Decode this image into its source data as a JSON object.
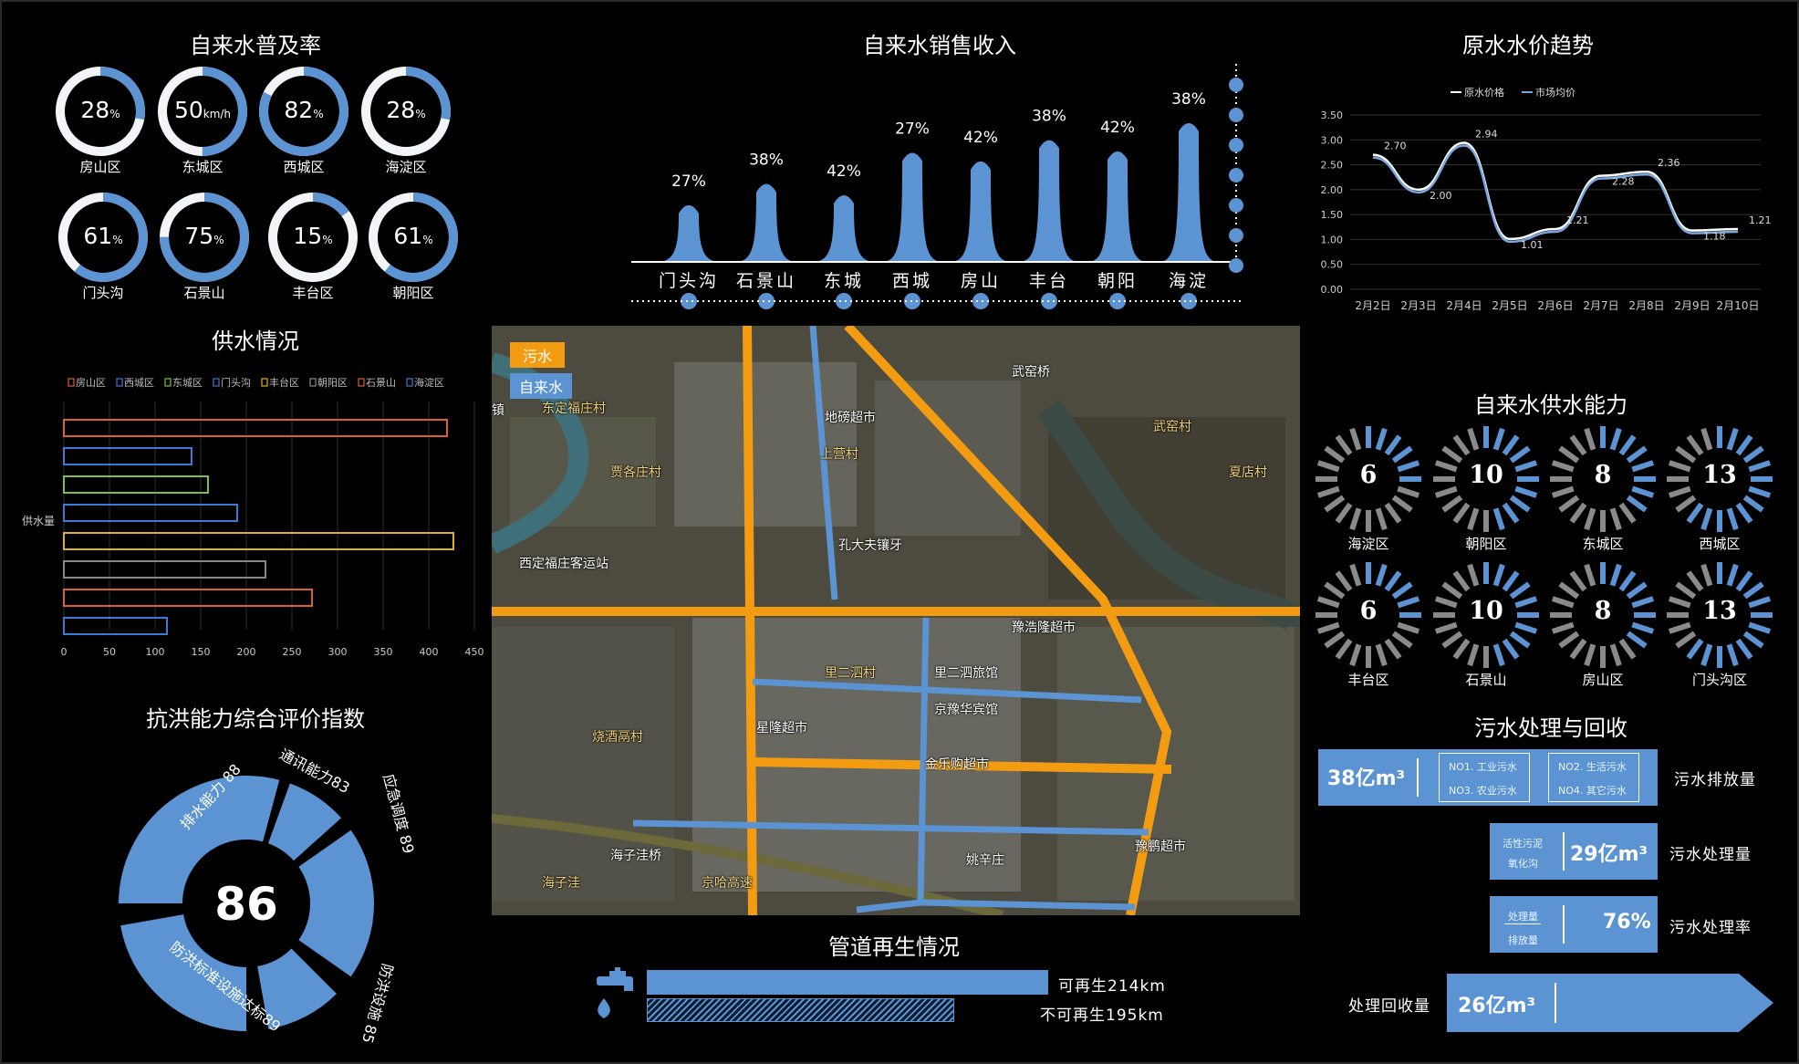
{
  "titles": {
    "coverage": "自来水普及率",
    "sales": "自来水销售收入",
    "price": "原水水价趋势",
    "supply": "供水情况",
    "capacity": "自来水供水能力",
    "flood": "抗洪能力综合评价指数",
    "sewage": "污水处理与回收",
    "pipe": "管道再生情况"
  },
  "colors": {
    "accent": "#5b93d3",
    "ring_bg": "#ffffff",
    "orange": "#f39c12"
  },
  "coverage_rings": [
    {
      "label": "房山区",
      "value": "28",
      "unit": "%",
      "fraction": 0.28
    },
    {
      "label": "东城区",
      "value": "50",
      "unit": "km/h",
      "fraction": 0.5
    },
    {
      "label": "西城区",
      "value": "82",
      "unit": "%",
      "fraction": 0.82
    },
    {
      "label": "海淀区",
      "value": "28",
      "unit": "%",
      "fraction": 0.28
    },
    {
      "label": "门头沟",
      "value": "61",
      "unit": "%",
      "fraction": 0.61
    },
    {
      "label": "石景山",
      "value": "75",
      "unit": "%",
      "fraction": 0.75
    },
    {
      "label": "丰台区",
      "value": "15",
      "unit": "%",
      "fraction": 0.15
    },
    {
      "label": "朝阳区",
      "value": "61",
      "unit": "%",
      "fraction": 0.61
    }
  ],
  "capacity": [
    {
      "label": "海淀区",
      "value": "6",
      "filled": 6
    },
    {
      "label": "朝阳区",
      "value": "10",
      "filled": 10
    },
    {
      "label": "东城区",
      "value": "8",
      "filled": 8
    },
    {
      "label": "西城区",
      "value": "13",
      "filled": 13
    },
    {
      "label": "丰台区",
      "value": "6",
      "filled": 6
    },
    {
      "label": "石景山",
      "value": "10",
      "filled": 10
    },
    {
      "label": "房山区",
      "value": "8",
      "filled": 8
    },
    {
      "label": "门头沟区",
      "value": "13",
      "filled": 13
    }
  ],
  "flood": {
    "center": "86",
    "segments": [
      {
        "label": "排水能力 88",
        "value": 88
      },
      {
        "label": "通讯能力83",
        "value": 83
      },
      {
        "label": "应急调度 89",
        "value": 89
      },
      {
        "label": "防洪设施 85",
        "value": 85
      },
      {
        "label": "防洪标准设施达标89",
        "value": 89
      }
    ]
  },
  "sewage": {
    "discharge": {
      "value": "38亿m³",
      "label": "污水排放量",
      "items": [
        "NO1. 工业污水",
        "NO2. 生活污水",
        "NO3. 农业污水",
        "NO4. 其它污水"
      ]
    },
    "treated": {
      "value": "29亿m³",
      "label": "污水处理量",
      "sub": [
        "活性污泥",
        "氧化沟"
      ]
    },
    "rate": {
      "value": "76%",
      "label": "污水处理率",
      "sub": [
        "处理量",
        "排放量"
      ]
    },
    "recycled": {
      "value": "26亿m³",
      "label": "处理回收量"
    }
  },
  "pipe": {
    "renewable": {
      "label": "可再生214km",
      "value": 214
    },
    "nonrenewable": {
      "label": "不可再生195km",
      "value": 195
    }
  },
  "map": {
    "legend": [
      "污水",
      "自来水"
    ],
    "places": [
      "武窑桥",
      "地磅超市",
      "东定福庄村",
      "贾各庄村",
      "西定福庄客运站",
      "孔大夫镶牙",
      "武窑村",
      "夏店村",
      "烧酒鬲村",
      "里二泗村",
      "里二泗旅馆",
      "豫浩隆超市",
      "京豫华宾馆",
      "星隆超市",
      "金乐购超市",
      "海子洼桥",
      "海子洼",
      "姚辛庄",
      "京哈高速",
      "豫鹏超市",
      "上营村",
      "镇"
    ]
  },
  "chart_data": [
    {
      "type": "area",
      "title": "自来水销售收入",
      "categories": [
        "门头沟",
        "石景山",
        "东城",
        "西城",
        "房山",
        "丰台",
        "朝阳",
        "海淀"
      ],
      "values": [
        27,
        38,
        42,
        27,
        42,
        38,
        42,
        38
      ],
      "labels": [
        "27%",
        "38%",
        "42%",
        "27%",
        "42%",
        "38%",
        "42%",
        "38%"
      ],
      "heights": [
        0.42,
        0.57,
        0.49,
        0.79,
        0.73,
        0.88,
        0.8,
        1.0
      ]
    },
    {
      "type": "line",
      "title": "原水水价趋势",
      "x": [
        "2月2日",
        "2月3日",
        "2月4日",
        "2月5日",
        "2月6日",
        "2月7日",
        "2月8日",
        "2月9日",
        "2月10日"
      ],
      "series": [
        {
          "name": "原水价格",
          "values": [
            2.7,
            2.0,
            2.94,
            1.01,
            1.21,
            2.28,
            2.36,
            1.18,
            1.21
          ],
          "color": "#ffffff"
        },
        {
          "name": "市场均价",
          "values": [
            2.7,
            2.0,
            2.94,
            1.01,
            1.21,
            2.28,
            2.36,
            1.18,
            1.21
          ],
          "color": "#7aa7e0"
        }
      ],
      "point_labels": [
        "2.70",
        "2.00",
        "2.94",
        "1.01",
        "1.21",
        "2.28",
        "2.36",
        "1.18",
        "1.21"
      ],
      "yticks": [
        "0.00",
        "0.50",
        "1.00",
        "1.50",
        "2.00",
        "2.50",
        "3.00",
        "3.50"
      ],
      "ylim": [
        0,
        3.5
      ]
    },
    {
      "type": "bar",
      "title": "供水情况",
      "ylabel": "供水量",
      "orientation": "horizontal",
      "legend": [
        "房山区",
        "西城区",
        "东城区",
        "门头沟",
        "丰台区",
        "朝阳区",
        "石景山",
        "海淀区"
      ],
      "colors": [
        "#d9622a",
        "#3a7bd5",
        "#7bc043",
        "#3a7bd5",
        "#e0b020",
        "#888888",
        "#d9622a",
        "#3a7bd5"
      ],
      "values": [
        420,
        140,
        158,
        190,
        427,
        221,
        272,
        113
      ],
      "xticks": [
        "0",
        "50",
        "100",
        "150",
        "200",
        "250",
        "300",
        "350",
        "400",
        "450"
      ],
      "xlim": [
        0,
        450
      ]
    }
  ]
}
